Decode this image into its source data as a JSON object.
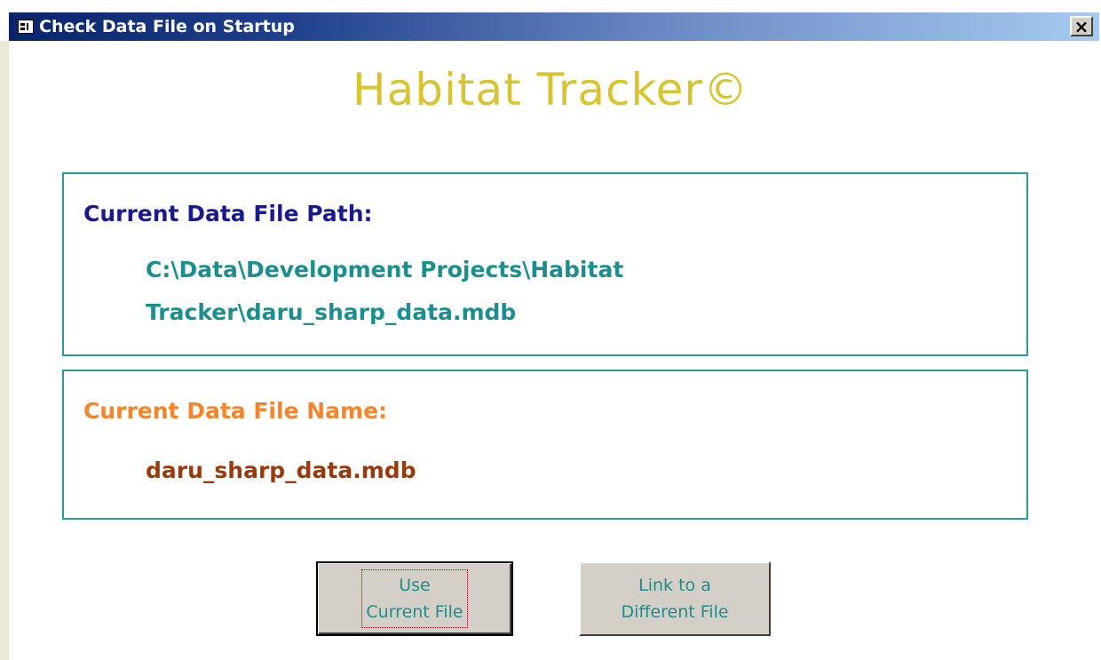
{
  "window": {
    "title": "Check Data File on Startup",
    "close_label": "×"
  },
  "app_title": "Habitat Tracker©",
  "path_panel": {
    "label": "Current Data File Path:",
    "value_line1": "C:\\Data\\Development Projects\\Habitat",
    "value_line2": "Tracker\\daru_sharp_data.mdb"
  },
  "name_panel": {
    "label": "Current Data File Name:",
    "value": "daru_sharp_data.mdb"
  },
  "buttons": {
    "use_current_line1": "Use",
    "use_current_line2": "Current File",
    "link_different_line1": "Link to a",
    "link_different_line2": "Different File"
  },
  "colors": {
    "title_gold": "#d8c431",
    "path_label": "#1a1a8c",
    "path_value": "#1b8f8f",
    "name_label": "#f5842b",
    "name_value": "#9a3a0a",
    "panel_border": "#2a9a9a",
    "button_text": "#1e8c8c"
  },
  "icons": {
    "window_icon": "form-icon",
    "close_icon": "close-icon"
  }
}
